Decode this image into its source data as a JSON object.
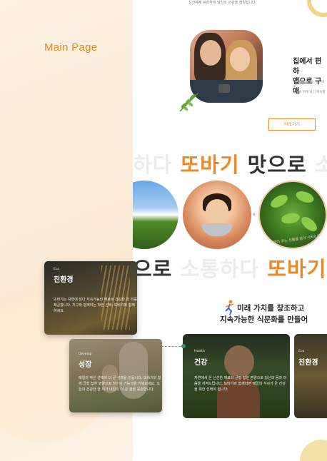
{
  "page_label": "Main Page",
  "hero": {
    "top_caption": "신선예계 관리하여 당신의 건강을 책임집니다.",
    "title_line1": "집에서 편하",
    "title_line2": "앱으로 구매",
    "desc_line1": "메뉴를 고민하는 당신에게",
    "desc_line2": "당신을 위해 담긴 메뉴를",
    "button_label": "바로가기"
  },
  "marquee_top": {
    "ghost_left": "하다",
    "orange": "또바기",
    "dark": "맛으로",
    "ghost_right": "소"
  },
  "marquee_bottom": {
    "dark": "으로",
    "ghost": "소통하다",
    "orange": "또바기"
  },
  "circles": {
    "circle3_text": "자연이 주는 선물을 담아 식탁으로",
    "nav_arrow": "‹"
  },
  "values": {
    "line1": "미래 가치를 창조하고",
    "line2": "지속가능한 식문화를 만들어"
  },
  "cards": {
    "health": {
      "tag": "Health",
      "title": "건강",
      "desc": "자연에서 온 신선한 재료와 균형 잡힌 영양으로 당신의 몸과 마음을 지켜드립니다. 또바기와 함께라면 매일의 식사가 곧 건강을 위한 선택이 됩니다."
    },
    "eco_right": {
      "tag": "Eco",
      "title": "친환경"
    }
  },
  "float_cards": {
    "eco": {
      "tag": "Eco",
      "title": "친환경",
      "desc": "또바기는 자연에 담다 지속가능한 재료로 건강한 한 끼를 제공합니다. 지구와 함께하는 착한 선택, 또바기와 함께하세요."
    },
    "growth": {
      "tag": "Develop",
      "title": "성장",
      "desc": "매일의 작은 선택이 더 큰 성장을 만듭니다. 또바기와 함께 균형 잡힌 영양으로 당신의 가능성을 키워보세요. 오늘의 건강한 한 끼가 내일의 더 큰 꿈을 응원합니다."
    }
  },
  "colors": {
    "accent": "#e88a2e",
    "background": "#fdf6ec"
  }
}
